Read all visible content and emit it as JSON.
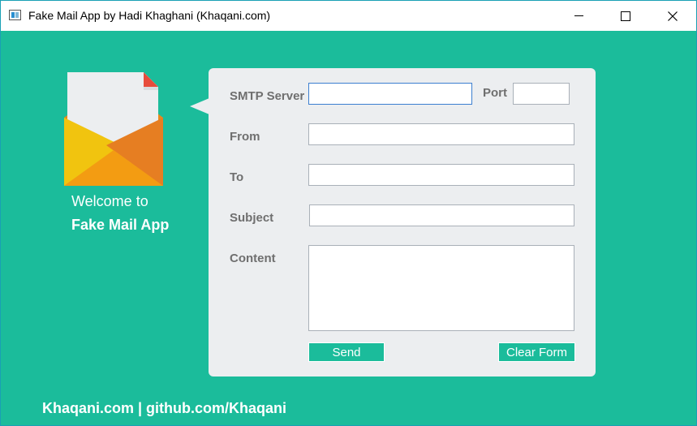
{
  "window": {
    "title": "Fake Mail App by Hadi Khaghani (Khaqani.com)"
  },
  "welcome": {
    "line1": "Welcome to",
    "line2": "Fake Mail App"
  },
  "form": {
    "smtp_label": "SMTP Server",
    "smtp_value": "",
    "port_label": "Port",
    "port_value": "",
    "from_label": "From",
    "from_value": "",
    "to_label": "To",
    "to_value": "",
    "subject_label": "Subject",
    "subject_value": "",
    "content_label": "Content",
    "content_value": "",
    "send_label": "Send",
    "clear_label": "Clear Form"
  },
  "footer": {
    "text": "Khaqani.com | github.com/Khaqani"
  },
  "colors": {
    "background": "#1bbc9b",
    "panel": "#eceef0",
    "label": "#6f6f6f",
    "button": "#1bbc9b"
  }
}
